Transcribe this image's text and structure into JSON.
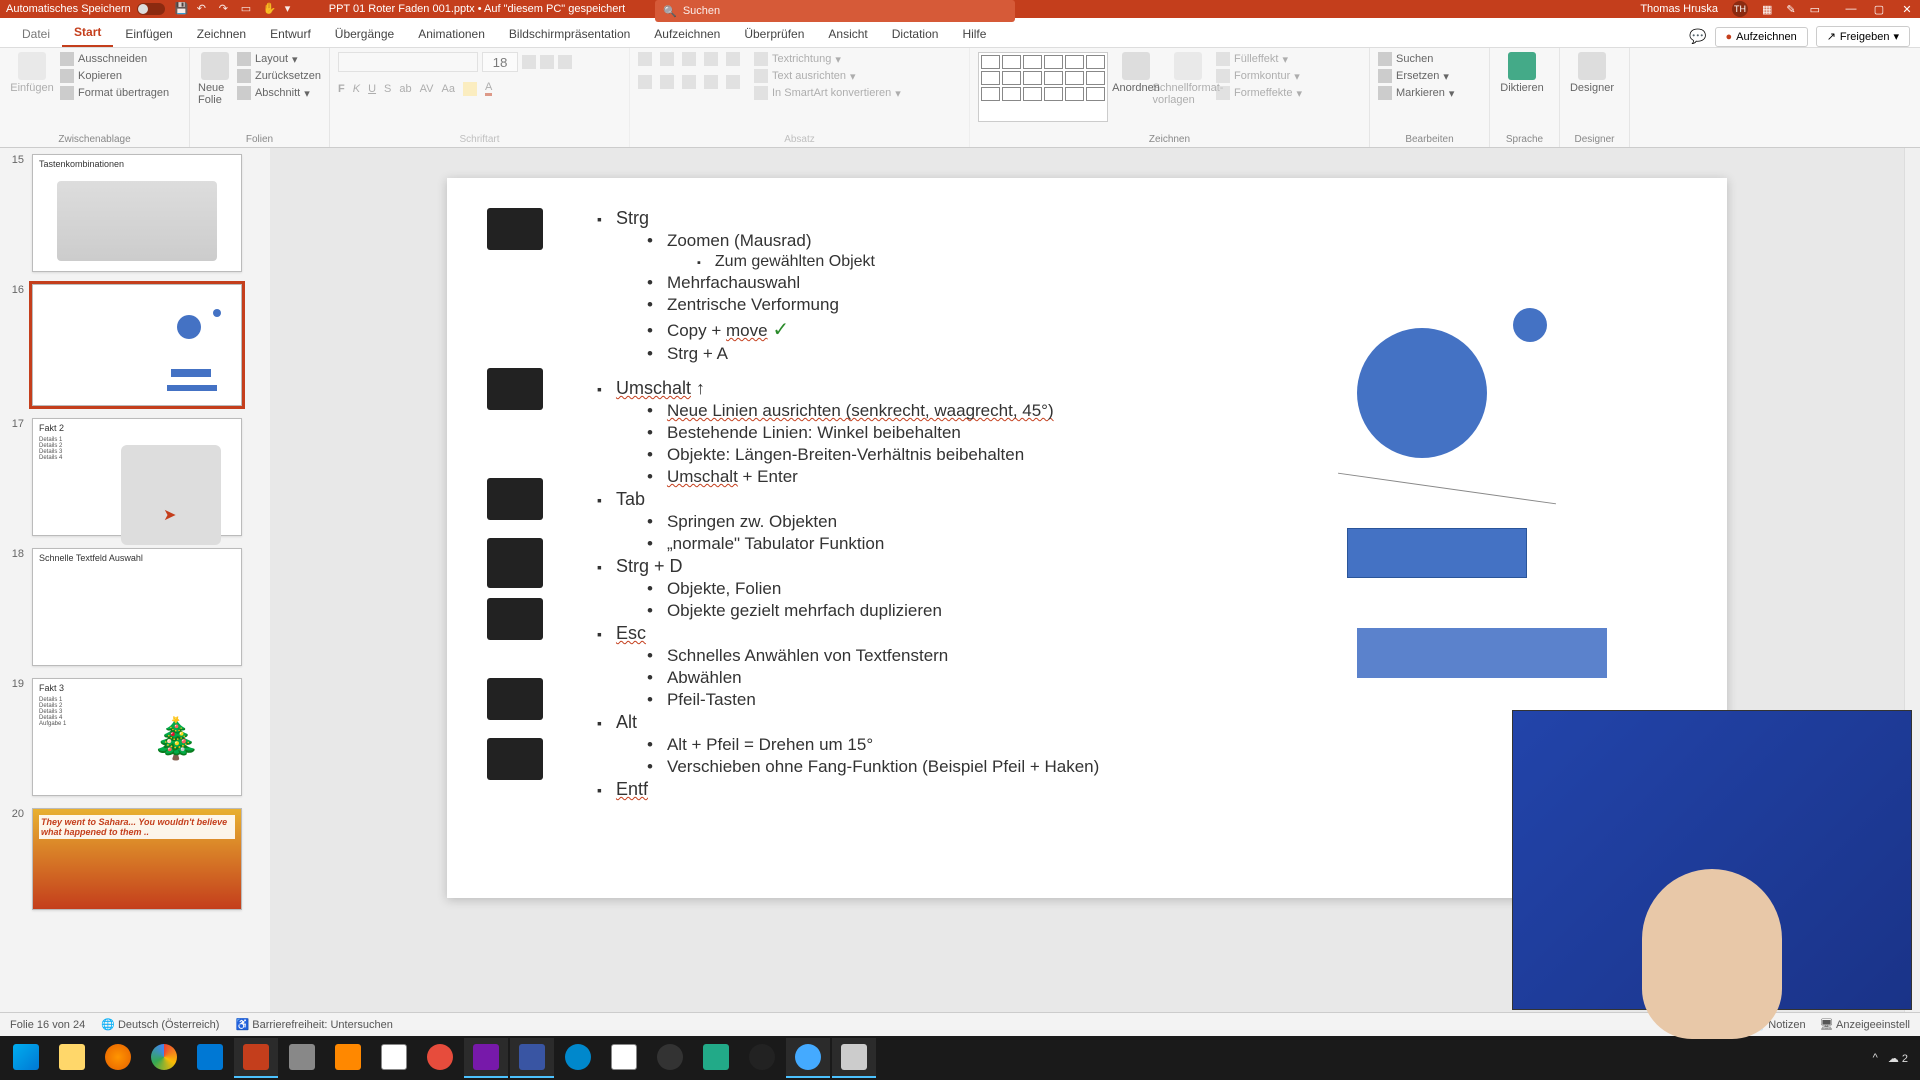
{
  "titlebar": {
    "autosave": "Automatisches Speichern",
    "doc": "PPT 01 Roter Faden 001.pptx • Auf \"diesem PC\" gespeichert",
    "searchPlaceholder": "Suchen",
    "user": "Thomas Hruska",
    "userInitials": "TH"
  },
  "tabs": {
    "file": "Datei",
    "items": [
      "Start",
      "Einfügen",
      "Zeichnen",
      "Entwurf",
      "Übergänge",
      "Animationen",
      "Bildschirmpräsentation",
      "Aufzeichnen",
      "Überprüfen",
      "Ansicht",
      "Dictation",
      "Hilfe"
    ],
    "active": "Start",
    "record": "Aufzeichnen",
    "share": "Freigeben"
  },
  "ribbon": {
    "clipboard": {
      "label": "Zwischenablage",
      "paste": "Einfügen",
      "cut": "Ausschneiden",
      "copy": "Kopieren",
      "format": "Format übertragen"
    },
    "slides": {
      "label": "Folien",
      "new": "Neue Folie",
      "layout": "Layout",
      "reset": "Zurücksetzen",
      "section": "Abschnitt"
    },
    "font": {
      "label": "Schriftart",
      "size": "18"
    },
    "paragraph": {
      "label": "Absatz",
      "textdir": "Textrichtung",
      "align": "Text ausrichten",
      "smartart": "In SmartArt konvertieren"
    },
    "drawing": {
      "label": "Zeichnen",
      "arrange": "Anordnen",
      "quickstyles": "Schnellformat-vorlagen",
      "fill": "Fülleffekt",
      "outline": "Formkontur",
      "effects": "Formeffekte"
    },
    "editing": {
      "label": "Bearbeiten",
      "find": "Suchen",
      "replace": "Ersetzen",
      "select": "Markieren"
    },
    "voice": {
      "label": "Sprache",
      "dictate": "Diktieren"
    },
    "designer": {
      "label": "Designer",
      "btn": "Designer"
    }
  },
  "thumbs": {
    "15": {
      "title": "Tastenkombinationen"
    },
    "16": {
      "title": ""
    },
    "17": {
      "title": "Fakt 2",
      "lines": [
        "Details 1",
        "Details 2",
        "Details 3",
        "Details 4"
      ]
    },
    "18": {
      "title": "Schnelle Textfeld Auswahl"
    },
    "19": {
      "title": "Fakt 3",
      "lines": [
        "Details 1",
        "Details 2",
        "Details 3",
        "Details 4",
        "Aufgabe 1"
      ]
    },
    "20": {
      "caption": "They went to Sahara... You wouldn't believe what happened to them .."
    }
  },
  "slide": {
    "strg": "Strg",
    "strg_items": [
      "Zoomen (Mausrad)",
      "Mehrfachauswahl",
      "Zentrische Verformung",
      "Copy + move",
      "Strg + A"
    ],
    "strg_sub": "Zum gewählten Objekt",
    "umschalt": "Umschalt",
    "umschalt_items": [
      "Neue Linien ausrichten (senkrecht, waagrecht, 45°)",
      "Bestehende Linien: Winkel beibehalten",
      "Objekte: Längen-Breiten-Verhältnis beibehalten",
      "Umschalt + Enter"
    ],
    "tab": "Tab",
    "tab_items": [
      "Springen zw. Objekten",
      "„normale\" Tabulator Funktion"
    ],
    "strgd": "Strg + D",
    "strgd_items": [
      "Objekte, Folien",
      "Objekte gezielt mehrfach duplizieren"
    ],
    "esc": "Esc",
    "esc_items": [
      "Schnelles Anwählen von Textfenstern",
      "Abwählen",
      "Pfeil-Tasten"
    ],
    "alt": "Alt",
    "alt_items": [
      "Alt + Pfeil = Drehen um 15°",
      "Verschieben ohne Fang-Funktion (Beispiel Pfeil + Haken)"
    ],
    "entf": "Entf"
  },
  "status": {
    "slide": "Folie 16 von 24",
    "lang": "Deutsch (Österreich)",
    "access": "Barrierefreiheit: Untersuchen",
    "notes": "Notizen",
    "display": "Anzeigeeinstell"
  },
  "tray": {
    "temp": "2"
  }
}
